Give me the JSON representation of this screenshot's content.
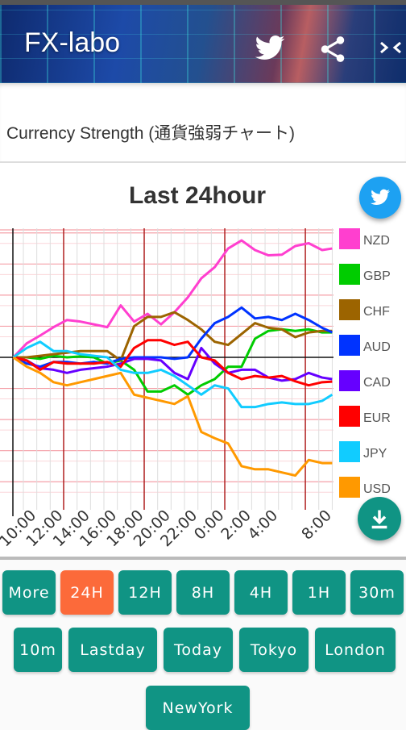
{
  "status_bar": {},
  "header": {
    "title": "FX-labo",
    "icons": [
      "twitter-icon",
      "share-icon",
      "code-icon"
    ]
  },
  "subheader": {
    "title": "Currency Strength (通貨強弱チャート)"
  },
  "fabs": {
    "twitter": {
      "icon": "twitter-icon",
      "color": "#1da1f2"
    },
    "download": {
      "icon": "download-icon",
      "color": "#109484"
    }
  },
  "chart_data": {
    "type": "line",
    "title": "Last 24hour",
    "xlabel": "",
    "ylabel": "",
    "x_ticks": [
      "10:00",
      "12:00",
      "14:00",
      "16:00",
      "18:00",
      "20:00",
      "22:00",
      "0:00",
      "2:00",
      "4:00",
      "8:00"
    ],
    "x": [
      "8:15",
      "9:15",
      "10:15",
      "11:15",
      "12:15",
      "13:15",
      "14:15",
      "15:15",
      "16:15",
      "17:15",
      "18:15",
      "19:15",
      "20:15",
      "21:15",
      "22:15",
      "23:15",
      "0:15",
      "1:15",
      "2:15",
      "3:15",
      "4:15",
      "5:15",
      "6:15",
      "7:15",
      "8:00"
    ],
    "ylim": [
      -4.7,
      4.15
    ],
    "grid": true,
    "legend": "right",
    "series": [
      {
        "name": "NZD",
        "color": "#ff3fcf",
        "values": [
          0,
          0.45,
          0.7,
          0.97,
          1.2,
          1.15,
          1.06,
          0.97,
          1.67,
          1.15,
          1.4,
          1.06,
          1.45,
          1.93,
          2.54,
          2.9,
          3.5,
          3.76,
          3.45,
          3.28,
          3.3,
          3.58,
          3.67,
          3.45,
          3.5
        ]
      },
      {
        "name": "GBP",
        "color": "#00cc00",
        "values": [
          0,
          0,
          -0.05,
          0.05,
          0,
          0.03,
          0,
          -0.2,
          -0.1,
          -0.4,
          -1.1,
          -1.1,
          -0.9,
          -1.2,
          -0.9,
          -0.7,
          -0.3,
          -0.3,
          0.6,
          0.85,
          0.9,
          0.85,
          0.9,
          0.8,
          0.8
        ]
      },
      {
        "name": "CHF",
        "color": "#9c6400",
        "values": [
          0,
          0,
          0.05,
          0.1,
          0.15,
          0.2,
          0.2,
          0.2,
          -0.1,
          1.0,
          1.3,
          1.3,
          1.45,
          1.2,
          0.9,
          0.5,
          0.4,
          0.75,
          1.1,
          0.95,
          0.9,
          0.65,
          0.8,
          0.85,
          0.85
        ]
      },
      {
        "name": "AUD",
        "color": "#0033ff",
        "values": [
          0,
          -0.2,
          -0.3,
          -0.15,
          -0.15,
          -0.2,
          -0.15,
          -0.2,
          -0.05,
          0,
          0,
          0,
          -0.05,
          0,
          0.6,
          1.1,
          1.3,
          1.6,
          1.25,
          1.3,
          1.2,
          1.4,
          1.2,
          0.95,
          0.8
        ]
      },
      {
        "name": "CAD",
        "color": "#6600ff",
        "values": [
          0,
          -0.1,
          -0.35,
          -0.4,
          -0.5,
          -0.4,
          -0.35,
          -0.3,
          -0.2,
          -0.05,
          -0.05,
          -0.1,
          -0.5,
          -0.7,
          0.3,
          -0.2,
          -0.5,
          -0.4,
          -0.4,
          -0.65,
          -0.75,
          -0.7,
          -0.5,
          -0.65,
          -0.7
        ]
      },
      {
        "name": "EUR",
        "color": "#ff0000",
        "values": [
          0,
          -0.1,
          -0.4,
          -0.15,
          -0.2,
          -0.2,
          -0.2,
          -0.15,
          -0.3,
          0.3,
          0.55,
          0.55,
          0.4,
          0.5,
          0,
          -0.1,
          -0.5,
          -0.7,
          -0.6,
          -0.65,
          -0.6,
          -0.77,
          -0.9,
          -0.8,
          -0.78
        ]
      },
      {
        "name": "JPY",
        "color": "#11ccff",
        "values": [
          0,
          0.3,
          0.5,
          0.2,
          0.2,
          0.1,
          0.05,
          0,
          -0.4,
          -0.5,
          -0.5,
          -0.4,
          -0.6,
          -0.9,
          -1.2,
          -0.9,
          -1.0,
          -1.6,
          -1.6,
          -1.5,
          -1.45,
          -1.5,
          -1.5,
          -1.4,
          -1.2
        ]
      },
      {
        "name": "USD",
        "color": "#ff9900",
        "values": [
          0,
          -0.3,
          -0.5,
          -0.8,
          -0.9,
          -0.8,
          -0.7,
          -0.6,
          -0.5,
          -1.2,
          -1.3,
          -1.4,
          -1.5,
          -1.25,
          -2.4,
          -2.6,
          -2.77,
          -3.5,
          -3.6,
          -3.6,
          -3.7,
          -3.8,
          -3.3,
          -3.4,
          -3.4
        ]
      }
    ]
  },
  "range_buttons": [
    {
      "label": "More",
      "active": false
    },
    {
      "label": "24H",
      "active": true
    },
    {
      "label": "12H",
      "active": false
    },
    {
      "label": "8H",
      "active": false
    },
    {
      "label": "4H",
      "active": false
    },
    {
      "label": "1H",
      "active": false
    },
    {
      "label": "30m",
      "active": false
    },
    {
      "label": "10m",
      "active": false
    },
    {
      "label": "Lastday",
      "active": false
    },
    {
      "label": "Today",
      "active": false
    },
    {
      "label": "Tokyo",
      "active": false
    },
    {
      "label": "London",
      "active": false
    },
    {
      "label": "NewYork",
      "active": false
    }
  ],
  "colors": {
    "button": "#109484",
    "button_active": "#fc6a3a"
  }
}
